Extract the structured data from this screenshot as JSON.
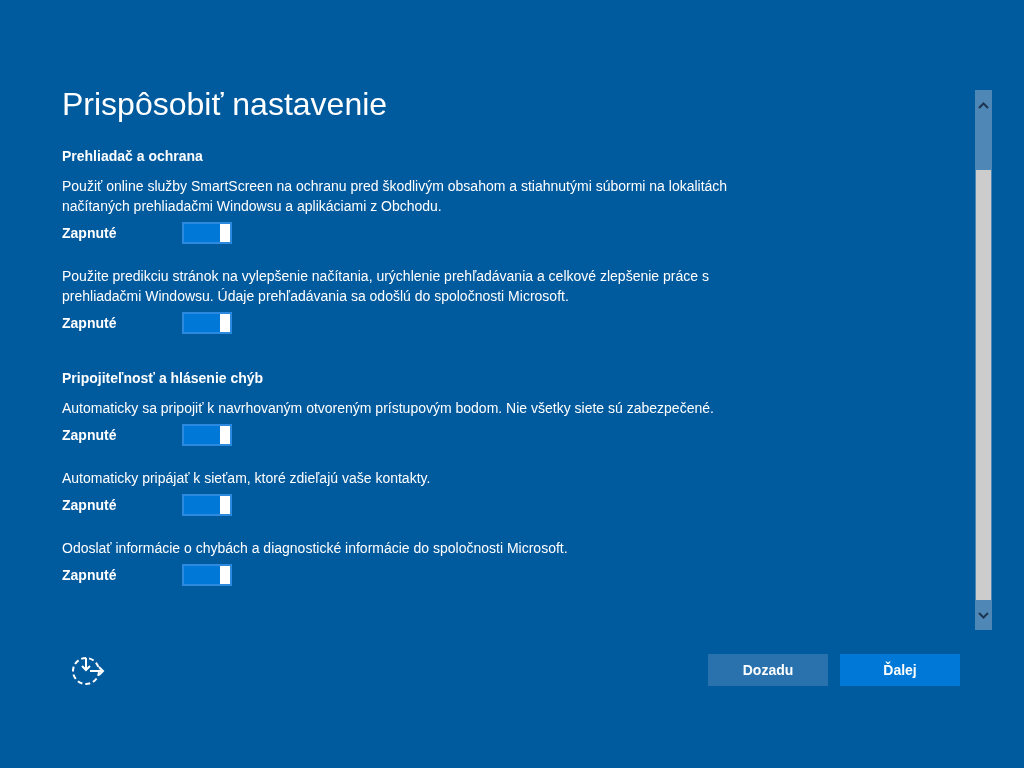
{
  "title": "Prispôsobiť nastavenie",
  "sections": [
    {
      "heading": "Prehliadač a ochrana",
      "settings": [
        {
          "description": "Použiť online služby SmartScreen na ochranu pred škodlivým obsahom a stiahnutými súbormi na lokalitách načítaných prehliadačmi Windowsu a aplikáciami z Obchodu.",
          "state_label": "Zapnuté",
          "on": true
        },
        {
          "description": "Použite predikciu stránok na vylepšenie načítania, urýchlenie prehľadávania a celkové zlepšenie práce s prehliadačmi Windowsu. Údaje prehľadávania sa odošlú do spoločnosti Microsoft.",
          "state_label": "Zapnuté",
          "on": true
        }
      ]
    },
    {
      "heading": "Pripojiteľnosť a hlásenie chýb",
      "settings": [
        {
          "description": "Automaticky sa pripojiť k navrhovaným otvoreným prístupovým bodom. Nie všetky siete sú zabezpečené.",
          "state_label": "Zapnuté",
          "on": true
        },
        {
          "description": "Automaticky pripájať k sieťam, ktoré zdieľajú vaše kontakty.",
          "state_label": "Zapnuté",
          "on": true
        },
        {
          "description": "Odoslať informácie o chybách a diagnostické informácie do spoločnosti Microsoft.",
          "state_label": "Zapnuté",
          "on": true
        }
      ]
    }
  ],
  "buttons": [
    {
      "label": "Dozadu",
      "kind": "secondary"
    },
    {
      "label": "Ďalej",
      "kind": "primary"
    }
  ]
}
